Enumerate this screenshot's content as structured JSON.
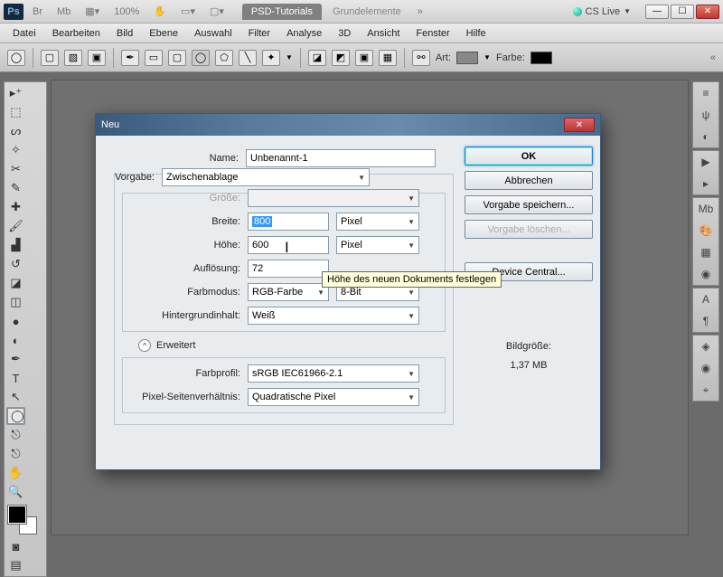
{
  "titlebar": {
    "zoom": "100%",
    "tab_active": "PSD-Tutorials",
    "tab_inactive": "Grundelemente",
    "cslive": "CS Live"
  },
  "menu": [
    "Datei",
    "Bearbeiten",
    "Bild",
    "Ebene",
    "Auswahl",
    "Filter",
    "Analyse",
    "3D",
    "Ansicht",
    "Fenster",
    "Hilfe"
  ],
  "optbar": {
    "art": "Art:",
    "farbe": "Farbe:"
  },
  "dialog": {
    "title": "Neu",
    "name_lbl": "Name:",
    "name_val": "Unbenannt-1",
    "vorgabe_lbl": "Vorgabe:",
    "vorgabe_val": "Zwischenablage",
    "groesse_lbl": "Größe:",
    "breite_lbl": "Breite:",
    "breite_val": "800",
    "breite_unit": "Pixel",
    "hoehe_lbl": "Höhe:",
    "hoehe_val": "600",
    "hoehe_unit": "Pixel",
    "aufl_lbl": "Auflösung:",
    "aufl_val": "72",
    "farbmodus_lbl": "Farbmodus:",
    "farbmodus_val": "RGB-Farbe",
    "farbmodus_bit": "8-Bit",
    "hintergrund_lbl": "Hintergrundinhalt:",
    "hintergrund_val": "Weiß",
    "erweitert": "Erweitert",
    "farbprofil_lbl": "Farbprofil:",
    "farbprofil_val": "sRGB IEC61966-2.1",
    "pixelratio_lbl": "Pixel-Seitenverhältnis:",
    "pixelratio_val": "Quadratische Pixel",
    "ok": "OK",
    "abbrechen": "Abbrechen",
    "vorgabe_speichern": "Vorgabe speichern...",
    "vorgabe_loeschen": "Vorgabe löschen...",
    "device_central": "Device Central...",
    "bildgroesse_lbl": "Bildgröße:",
    "bildgroesse_val": "1,37 MB",
    "tooltip": "Höhe des neuen Dokuments festlegen"
  }
}
